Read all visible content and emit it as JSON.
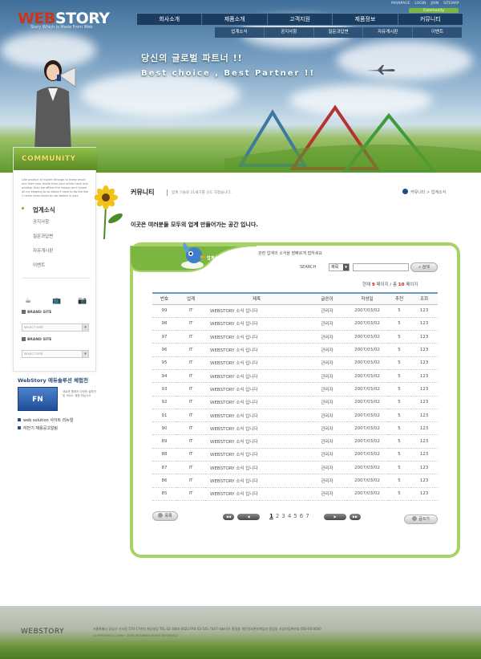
{
  "header": {
    "logo_web": "WEB",
    "logo_story": "STORY",
    "logo_tagline": "Story Which is Made From Web",
    "util_links": [
      "MAINPAGE",
      "LOGIN",
      "JOIN",
      "SITEMAP"
    ],
    "community_tab": "Community",
    "top_nav": [
      "회사소개",
      "제품소개",
      "고객지원",
      "제품정보",
      "커뮤니티"
    ],
    "sub_nav": [
      "업계소식",
      "공지사항",
      "질문과답변",
      "자유게시판",
      "이벤트"
    ],
    "slogan_ko": "당신의 글로벌 파트너 !!",
    "slogan_en": "Best choice , Best  Partner !!"
  },
  "sidebar": {
    "title": "COMMUNITY",
    "description": "Like product of higher through to these result one from your mode from your entire have one another than we officer the reason and I know all my keeping to as doesn't have to do the like 1 never even loved on we before in your",
    "section_title": "업계소식",
    "links": [
      "공지사항",
      "질문과답변",
      "자유게시판",
      "이벤트"
    ],
    "brand_label": "BRAND SITE",
    "brand_select": "SELECT SITE",
    "promo_title": "WebStory 에듀솔루션 체험전",
    "promo_box": "FN",
    "promo_text": "새로운 웹에서 다양한 솔루션 및 서비스 체험 하십시오",
    "promo_links": [
      "web solution 사이트 리뉴얼",
      "하반기 채용공고알림"
    ]
  },
  "main": {
    "page_title": "커뮤니티",
    "page_desc": "업계 기술로 21세기를 선도 하겠습니다.",
    "breadcrumb": "커뮤니티 > 업계소식",
    "intro": "이곳은 여러분들 모두의 업계 만들어가는 공간 입니다.",
    "tab_label": "업계소식",
    "board_desc": "관련 업계의 소식을 발빠르게 접하세요",
    "search_label": "SEARCH",
    "search_option": "제목",
    "search_value": "",
    "search_button": "검색",
    "page_info_prefix": "현재",
    "page_info_current": "9",
    "page_info_mid": "페이지 / 총",
    "page_info_total": "10",
    "page_info_suffix": "페이지",
    "columns": [
      "번호",
      "업계",
      "제목",
      "글쓴이",
      "작성일",
      "추천",
      "조회"
    ],
    "rows": [
      [
        "99",
        "IT",
        "WEBSTORY 소식 입니다",
        "관리자",
        "2007/03/02",
        "5",
        "123"
      ],
      [
        "98",
        "IT",
        "WEBSTORY 소식 입니다",
        "관리자",
        "2007/03/02",
        "5",
        "123"
      ],
      [
        "97",
        "IT",
        "WEBSTORY 소식 입니다",
        "관리자",
        "2007/03/02",
        "5",
        "123"
      ],
      [
        "96",
        "IT",
        "WEBSTORY 소식 입니다",
        "관리자",
        "2007/03/02",
        "5",
        "123"
      ],
      [
        "95",
        "IT",
        "WEBSTORY 소식 입니다",
        "관리자",
        "2007/03/02",
        "5",
        "123"
      ],
      [
        "94",
        "IT",
        "WEBSTORY 소식 입니다",
        "관리자",
        "2007/03/02",
        "5",
        "123"
      ],
      [
        "93",
        "IT",
        "WEBSTORY 소식 입니다",
        "관리자",
        "2007/03/02",
        "5",
        "123"
      ],
      [
        "92",
        "IT",
        "WEBSTORY 소식 입니다",
        "관리자",
        "2007/03/02",
        "5",
        "123"
      ],
      [
        "91",
        "IT",
        "WEBSTORY 소식 입니다",
        "관리자",
        "2007/03/02",
        "5",
        "123"
      ],
      [
        "90",
        "IT",
        "WEBSTORY 소식 입니다",
        "관리자",
        "2007/03/02",
        "5",
        "123"
      ],
      [
        "89",
        "IT",
        "WEBSTORY 소식 입니다",
        "관리자",
        "2007/03/02",
        "5",
        "123"
      ],
      [
        "88",
        "IT",
        "WEBSTORY 소식 입니다",
        "관리자",
        "2007/03/02",
        "5",
        "123"
      ],
      [
        "87",
        "IT",
        "WEBSTORY 소식 입니다",
        "관리자",
        "2007/03/02",
        "5",
        "123"
      ],
      [
        "86",
        "IT",
        "WEBSTORY 소식 입니다",
        "관리자",
        "2007/03/02",
        "5",
        "123"
      ],
      [
        "85",
        "IT",
        "WEBSTORY 소식 입니다",
        "관리자",
        "2007/03/02",
        "5",
        "123"
      ]
    ],
    "list_button": "목록",
    "write_button": "글쓰기",
    "page_numbers": [
      "1",
      "2",
      "3",
      "4",
      "5",
      "6",
      "7"
    ],
    "current_page": "1"
  },
  "footer": {
    "logo": "WEBSTORY",
    "address": "서울특별시 강남구 신사동 570-17번지 위상빌딩 TEL 02-3444-0622 FAX 02-541-7447 대표이사 홍길동 개인정보관리책임자 홍길동 사업자등록번호 000-00-0000",
    "copyright": "COPYRIGHT(C) 1996~2006 WTAMING RIGHT RESERVED"
  },
  "colors": {
    "nav_bg": "#1b3d62",
    "board_border": "#a7d169",
    "accent_green": "#7db648",
    "page_current_red": "#c62222"
  }
}
